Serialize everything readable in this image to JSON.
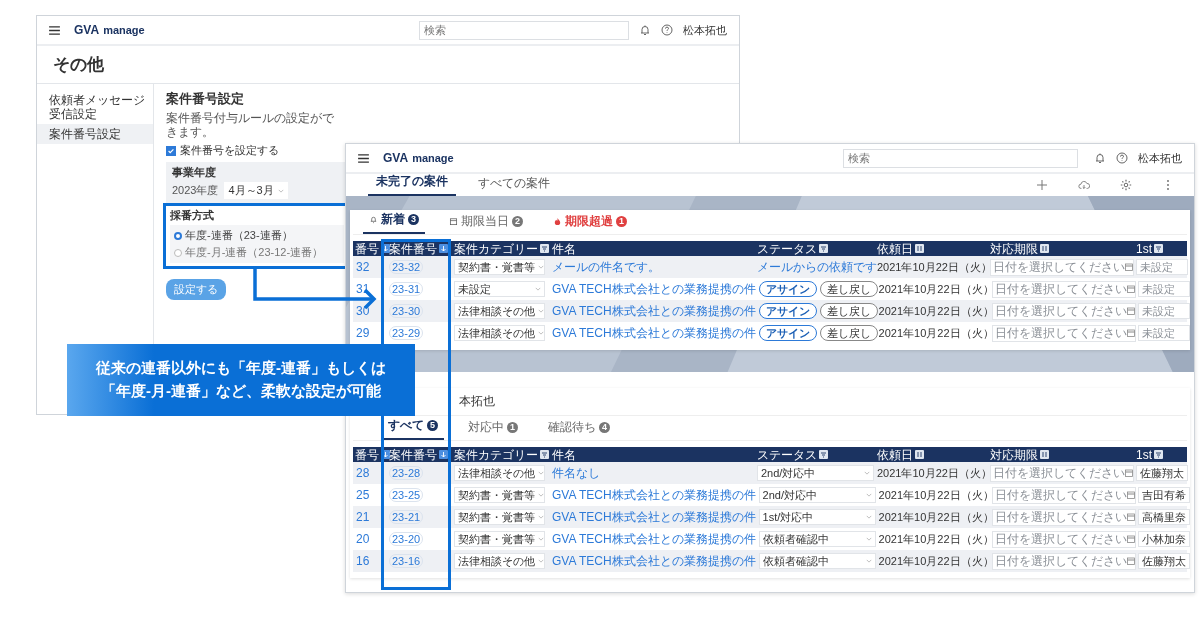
{
  "back_window": {
    "logo": "GVA",
    "logo_suffix": "manage",
    "search_placeholder": "検索",
    "user": "松本拓也",
    "title": "その他",
    "sidebar": [
      {
        "label": "依頼者メッセージ受信設定",
        "selected": false
      },
      {
        "label": "案件番号設定",
        "selected": true
      }
    ],
    "settings": {
      "heading": "案件番号設定",
      "description": "案件番号付与ルールの設定ができます。",
      "checkbox": {
        "label": "案件番号を設定する",
        "checked": true
      },
      "fiscal_label": "事業年度",
      "fiscal_year": "2023年度",
      "fiscal_range": "4月～3月",
      "numbering_label": "採番方式",
      "options": [
        {
          "label": "年度-連番（23-連番）",
          "selected": true
        },
        {
          "label": "年度-月-連番（23-12-連番）",
          "selected": false
        }
      ],
      "button": "設定する"
    }
  },
  "front_window": {
    "logo": "GVA",
    "logo_suffix": "manage",
    "search_placeholder": "検索",
    "user": "松本拓也",
    "tabs": [
      {
        "label": "未完了の案件",
        "selected": true
      },
      {
        "label": "すべての案件",
        "selected": false
      }
    ],
    "panels": [
      {
        "tabs": [
          {
            "label": "新着",
            "count": "3",
            "kind": "new",
            "selected": true
          },
          {
            "label": "期限当日",
            "count": "2",
            "kind": "today",
            "selected": false
          },
          {
            "label": "期限超過",
            "count": "1",
            "kind": "overdue",
            "selected": false
          }
        ],
        "columns": [
          {
            "label": "番号",
            "kind": "sort-active"
          },
          {
            "label": "案件番号",
            "kind": "sort-active"
          },
          {
            "label": "案件カテゴリー",
            "kind": "filter"
          },
          {
            "label": "件名",
            "kind": "plain"
          },
          {
            "label": "ステータス",
            "kind": "filter"
          },
          {
            "label": "依頼日",
            "kind": "sort"
          },
          {
            "label": "対応期限",
            "kind": "sort"
          },
          {
            "label": "1st",
            "kind": "filter"
          }
        ],
        "rows": [
          {
            "number": "32",
            "case_no": "23-32",
            "category": "契約書・覚書等",
            "subject": "メールの件名です。",
            "status": {
              "kind": "link",
              "text": "メールからの依頼です"
            },
            "requested": "2021年10月22日（火）",
            "deadline_placeholder": "日付を選択してください",
            "first_placeholder": "未設定"
          },
          {
            "number": "31",
            "case_no": "23-31",
            "category": "未設定",
            "subject": "GVA TECH株式会社との業務提携の件",
            "status": {
              "kind": "actions",
              "buttons": [
                "アサイン",
                "差し戻し"
              ]
            },
            "requested": "2021年10月22日（火）",
            "deadline_placeholder": "日付を選択してください",
            "first_placeholder": "未設定"
          },
          {
            "number": "30",
            "case_no": "23-30",
            "category": "法律相談その他",
            "subject": "GVA TECH株式会社との業務提携の件",
            "status": {
              "kind": "actions",
              "buttons": [
                "アサイン",
                "差し戻し"
              ]
            },
            "requested": "2021年10月22日（火）",
            "deadline_placeholder": "日付を選択してください",
            "first_placeholder": "未設定"
          },
          {
            "number": "29",
            "case_no": "23-29",
            "category": "法律相談その他",
            "subject": "GVA TECH株式会社との業務提携の件",
            "status": {
              "kind": "actions",
              "buttons": [
                "アサイン",
                "差し戻し"
              ]
            },
            "requested": "2021年10月22日（火）",
            "deadline_placeholder": "日付を選択してください",
            "first_placeholder": "未設定"
          }
        ]
      },
      {
        "title": "本拓也",
        "tabs": [
          {
            "label": "すべて",
            "count": "5",
            "kind": "plain",
            "selected": true
          },
          {
            "label": "対応中",
            "count": "1",
            "kind": "plain",
            "selected": false
          },
          {
            "label": "確認待ち",
            "count": "4",
            "kind": "plain",
            "selected": false
          }
        ],
        "columns": [
          {
            "label": "番号",
            "kind": "sort-active"
          },
          {
            "label": "案件番号",
            "kind": "sort-active"
          },
          {
            "label": "案件カテゴリー",
            "kind": "filter"
          },
          {
            "label": "件名",
            "kind": "plain"
          },
          {
            "label": "ステータス",
            "kind": "filter"
          },
          {
            "label": "依頼日",
            "kind": "sort"
          },
          {
            "label": "対応期限",
            "kind": "sort"
          },
          {
            "label": "1st",
            "kind": "filter"
          }
        ],
        "rows": [
          {
            "number": "28",
            "case_no": "23-28",
            "category": "法律相談その他",
            "subject": "件名なし",
            "status": {
              "kind": "select",
              "text": "2nd/対応中"
            },
            "requested": "2021年10月22日（火）",
            "deadline_placeholder": "日付を選択してください",
            "first": "佐藤翔太"
          },
          {
            "number": "25",
            "case_no": "23-25",
            "category": "契約書・覚書等",
            "subject": "GVA TECH株式会社との業務提携の件",
            "status": {
              "kind": "select",
              "text": "2nd/対応中"
            },
            "requested": "2021年10月22日（火）",
            "deadline_placeholder": "日付を選択してください",
            "first": "吉田有希"
          },
          {
            "number": "21",
            "case_no": "23-21",
            "category": "契約書・覚書等",
            "subject": "GVA TECH株式会社との業務提携の件",
            "status": {
              "kind": "select",
              "text": "1st/対応中"
            },
            "requested": "2021年10月22日（火）",
            "deadline_placeholder": "日付を選択してください",
            "first": "高橋里奈"
          },
          {
            "number": "20",
            "case_no": "23-20",
            "category": "契約書・覚書等",
            "subject": "GVA TECH株式会社との業務提携の件",
            "status": {
              "kind": "select",
              "text": "依頼者確認中"
            },
            "requested": "2021年10月22日（火）",
            "deadline_placeholder": "日付を選択してください",
            "first": "小林加奈"
          },
          {
            "number": "16",
            "case_no": "23-16",
            "category": "法律相談その他",
            "subject": "GVA TECH株式会社との業務提携の件",
            "status": {
              "kind": "select",
              "text": "依頼者確認中"
            },
            "requested": "2021年10月22日（火）",
            "deadline_placeholder": "日付を選択してください",
            "first": "佐藤翔太"
          }
        ]
      }
    ]
  },
  "callout": {
    "lines": [
      "従来の連番以外にも「年度-連番」もしくは",
      "「年度-月-連番」など、柔軟な設定が可能"
    ]
  }
}
